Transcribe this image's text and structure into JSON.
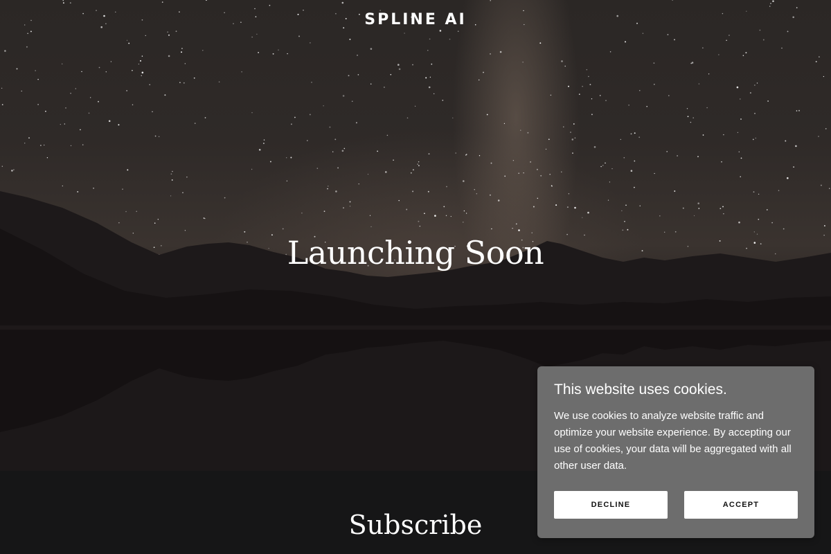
{
  "brand": {
    "name": "SPLINE AI"
  },
  "hero": {
    "headline": "Launching Soon"
  },
  "subscribe": {
    "title": "Subscribe"
  },
  "cookie_banner": {
    "title": "This website uses cookies.",
    "body": "We use cookies to analyze website traffic and optimize your website experience. By accepting our use of cookies, your data will be aggregated with all other user data.",
    "decline_label": "DECLINE",
    "accept_label": "ACCEPT"
  },
  "colors": {
    "page_background": "#161617",
    "cookie_background": "#6d6d6d",
    "button_background": "#ffffff",
    "text_primary": "#ffffff"
  }
}
